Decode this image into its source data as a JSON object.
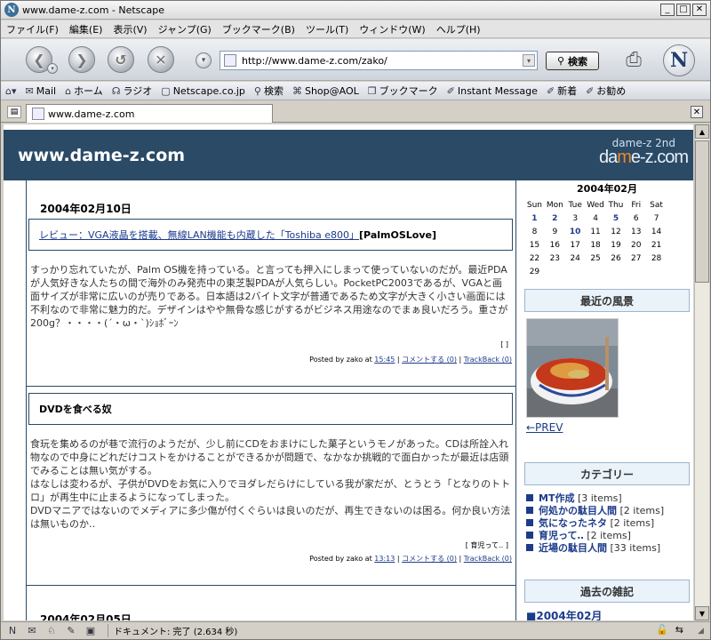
{
  "window": {
    "title": "www.dame-z.com - Netscape"
  },
  "menu": [
    "ファイル(F)",
    "編集(E)",
    "表示(V)",
    "ジャンプ(G)",
    "ブックマーク(B)",
    "ツール(T)",
    "ウィンドウ(W)",
    "ヘルプ(H)"
  ],
  "nav": {
    "url": "http://www.dame-z.com/zako/",
    "search_label": "検索"
  },
  "bookmarks": [
    {
      "label": "Mail",
      "icon": "mail-icon"
    },
    {
      "label": "ホーム",
      "icon": "home-icon"
    },
    {
      "label": "ラジオ",
      "icon": "radio-icon"
    },
    {
      "label": "Netscape.co.jp",
      "icon": "my-icon"
    },
    {
      "label": "検索",
      "icon": "search-icon"
    },
    {
      "label": "Shop@AOL",
      "icon": "shop-icon"
    },
    {
      "label": "ブックマーク",
      "icon": "bookmark-icon"
    },
    {
      "label": "Instant Message",
      "icon": "im-icon"
    },
    {
      "label": "新着",
      "icon": "new-icon"
    },
    {
      "label": "お勧め",
      "icon": "recommend-icon"
    }
  ],
  "tab": {
    "title": "www.dame-z.com"
  },
  "status": {
    "text": "ドキュメント: 完了 (2.634 秒)"
  },
  "page": {
    "site_title": "www.dame-z.com",
    "logo_sub": "dame-z 2nd",
    "logo_pre": "da",
    "logo_mid": "m",
    "logo_post": "e-z.com",
    "entries": [
      {
        "date": "2004年02月10日",
        "title_link": "レビュー：VGA液晶を搭載、無線LAN機能も内蔵した「Toshiba e800」",
        "title_tag": "[PalmOSLove]",
        "body": "すっかり忘れていたが、Palm OS機を持っている。と言っても押入にしまって使っていないのだが。最近PDAが人気好きな人たちの間で海外のみ発売中の東芝製PDAが人気らしい。PocketPC2003であるが、VGAと画面サイズが非常に広いのが売りである。日本語は2バイト文字が普通であるため文字が大きく小さい画面には不利なので非常に魅力的だ。デザインはやや無骨な感じがするがビジネス用途なのでまぁ良いだろう。重さが200g？・・・・(´・ω・`)ｼｮﾎﾞｰﾝ",
        "more": "[ ]",
        "posted": "Posted by zako at",
        "time": "15:45",
        "comments": "コメントする (0)",
        "trackback": "TrackBack (0)"
      },
      {
        "date": "",
        "title_link": "",
        "title_tag": "DVDを食べる奴",
        "body": "食玩を集めるのが巷で流行のようだが、少し前にCDをおまけにした菓子というモノがあった。CDは所詮入れ物なので中身にどれだけコストをかけることができるかが問題で、なかなか挑戦的で面白かったが最近は店頭でみることは無い気がする。\nはなしは変わるが、子供がDVDをお気に入りでヨダレだらけにしている我が家だが、とうとう「となりのトトロ」が再生中に止まるようになってしまった。\nDVDマニアではないのでメディアに多少傷が付くぐらいは良いのだが、再生できないのは困る。何か良い方法は無いものか‥",
        "more": "[ 育児って‥ ]",
        "posted": "Posted by zako at",
        "time": "13:13",
        "comments": "コメントする (0)",
        "trackback": "TrackBack (0)"
      }
    ],
    "next_date": "2004年02月05日"
  },
  "sidebar": {
    "calendar": {
      "month": "2004年02月",
      "weekdays": [
        "Sun",
        "Mon",
        "Tue",
        "Wed",
        "Thu",
        "Fri",
        "Sat"
      ],
      "rows": [
        [
          "1",
          "2",
          "3",
          "4",
          "5",
          "6",
          "7"
        ],
        [
          "8",
          "9",
          "10",
          "11",
          "12",
          "13",
          "14"
        ],
        [
          "15",
          "16",
          "17",
          "18",
          "19",
          "20",
          "21"
        ],
        [
          "22",
          "23",
          "24",
          "25",
          "26",
          "27",
          "28"
        ],
        [
          "29",
          "",
          "",
          "",
          "",
          "",
          ""
        ]
      ],
      "bold_days": [
        "1",
        "2",
        "5",
        "10"
      ]
    },
    "recent_heading": "最近の風景",
    "prev_label": "←PREV",
    "category_heading": "カテゴリー",
    "categories": [
      {
        "name": "MT作成",
        "count": "[3 items]"
      },
      {
        "name": "何処かの駄目人間",
        "count": "[2 items]"
      },
      {
        "name": "気になったネタ",
        "count": "[2 items]"
      },
      {
        "name": "育児って‥",
        "count": "[2 items]"
      },
      {
        "name": "近場の駄目人間",
        "count": "[33 items]"
      }
    ],
    "archive_heading": "過去の雑記",
    "archive_first": "■2004年02月"
  }
}
